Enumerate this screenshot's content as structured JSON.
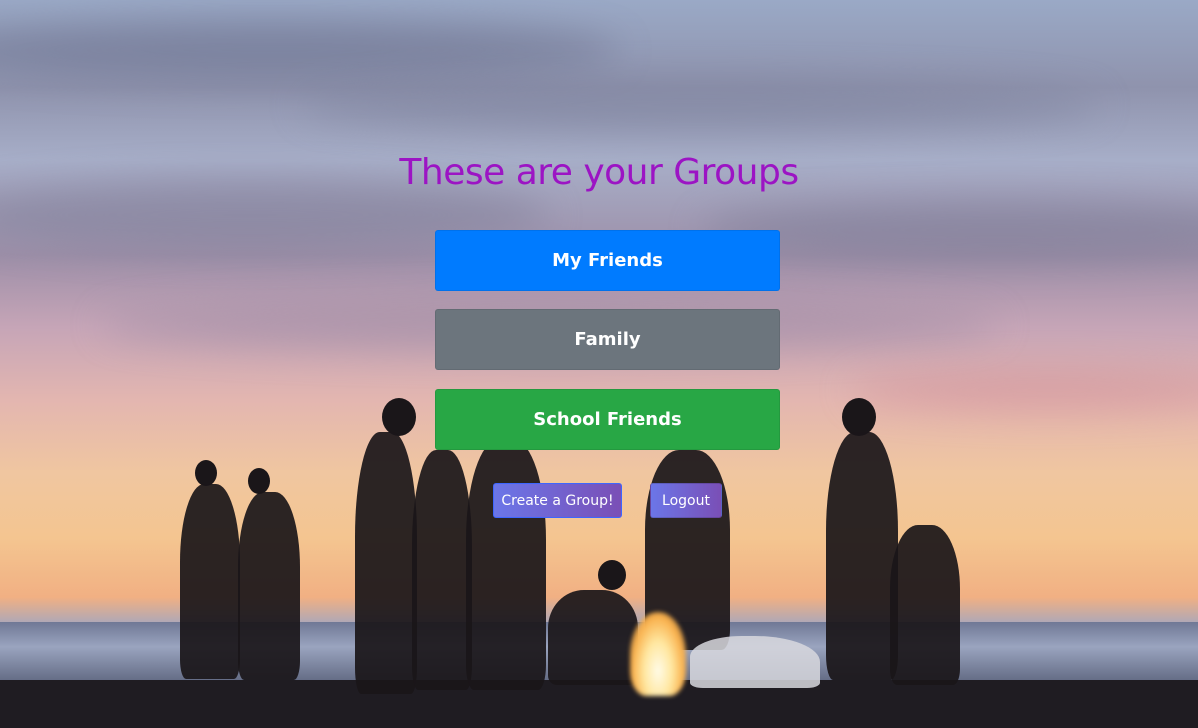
{
  "page": {
    "title": "These are your Groups"
  },
  "groups": [
    {
      "label": "My Friends",
      "color": "#007bff"
    },
    {
      "label": "Family",
      "color": "#6c757d"
    },
    {
      "label": "School Friends",
      "color": "#28a745"
    }
  ],
  "actions": {
    "create_label": "Create a Group!",
    "logout_label": "Logout"
  },
  "colors": {
    "title": "#9c14c4",
    "action_gradient_start": "#6b76e8",
    "action_gradient_end": "#7a4fb6"
  }
}
